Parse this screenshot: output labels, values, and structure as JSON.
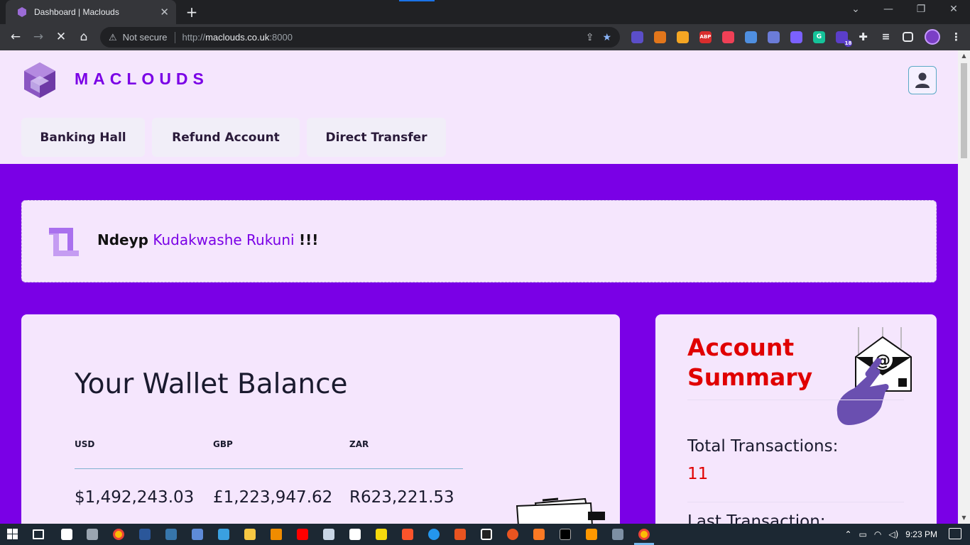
{
  "browser": {
    "tab_title": "Dashboard | Maclouds",
    "tab_close": "✕",
    "new_tab": "+",
    "window_controls": [
      "⌄",
      "—",
      "❐",
      "✕"
    ],
    "nav": {
      "back": "←",
      "forward": "→",
      "reload": "✕",
      "home": "⌂"
    },
    "security_icon": "⚠",
    "security_label": "Not secure",
    "url_prefix": "http://",
    "url_host": "maclouds.co.uk",
    "url_suffix": ":8000",
    "share": "⇪",
    "bookmark": "★",
    "extension_badge": "18",
    "extensions": [
      {
        "name": "ghost-extension-icon",
        "color": "#5b4ec9",
        "label": ""
      },
      {
        "name": "metamask-extension-icon",
        "color": "#e2761b",
        "label": ""
      },
      {
        "name": "spark-extension-icon",
        "color": "#f5a623",
        "label": ""
      },
      {
        "name": "abp-extension-icon",
        "color": "#d92d2d",
        "label": "ABP"
      },
      {
        "name": "pocket-extension-icon",
        "color": "#ef4056",
        "label": ""
      },
      {
        "name": "drop-extension-icon",
        "color": "#4f8fe0",
        "label": ""
      },
      {
        "name": "cursor-extension-icon",
        "color": "#6b7cd8",
        "label": ""
      },
      {
        "name": "bolt-extension-icon",
        "color": "#7b61ff",
        "label": ""
      },
      {
        "name": "grammarly-extension-icon",
        "color": "#15c39a",
        "label": "G"
      },
      {
        "name": "tag-extension-icon",
        "color": "#5b3ec9",
        "label": ""
      }
    ]
  },
  "site": {
    "brand": "MACLOUDS",
    "nav_tabs": [
      "Banking Hall",
      "Refund Account",
      "Direct Transfer"
    ],
    "welcome": {
      "greeting": "Ndeyp",
      "name": "Kudakwashe Rukuni",
      "suffix": "!!!"
    },
    "wallet": {
      "title": "Your Wallet Balance",
      "currencies": [
        {
          "code": "USD",
          "amount": "$1,492,243.03"
        },
        {
          "code": "GBP",
          "amount": "£1,223,947.62"
        },
        {
          "code": "ZAR",
          "amount": "R623,221.53"
        }
      ]
    },
    "summary": {
      "title": "Account Summary",
      "total_label": "Total Transactions:",
      "total_value": "11",
      "last_label": "Last Transaction:"
    }
  },
  "taskbar": {
    "time": "9:23 PM",
    "colors": {
      "accent": "#7a00e6",
      "alert": "#e00000",
      "header_bg": "#f5e6fd"
    }
  }
}
